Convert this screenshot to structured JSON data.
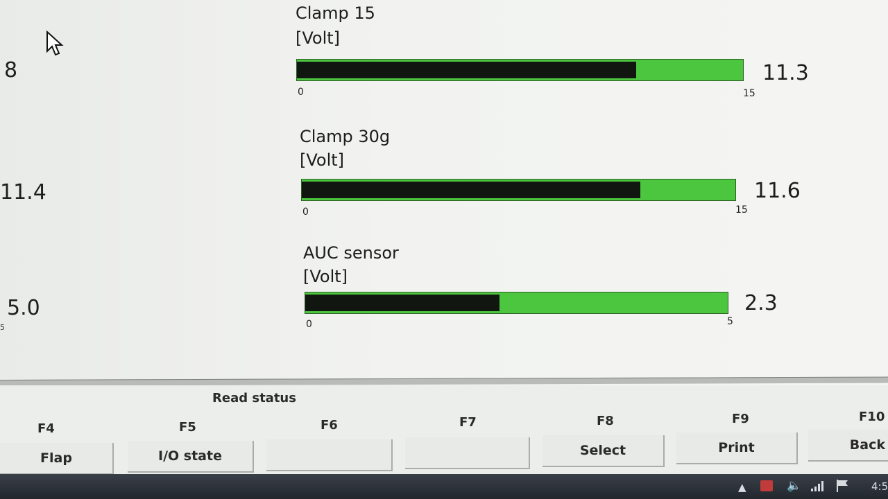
{
  "left_values": [
    "8",
    "11.4",
    "5.0"
  ],
  "left_tiny": "5",
  "gauges": [
    {
      "title": "Clamp 15",
      "unit": "[Volt]",
      "min": "0",
      "max": "15",
      "value": "11.3",
      "fill_fraction": 0.76
    },
    {
      "title": "Clamp 30g",
      "unit": "[Volt]",
      "min": "0",
      "max": "15",
      "value": "11.6",
      "fill_fraction": 0.78
    },
    {
      "title": "AUC sensor",
      "unit": "[Volt]",
      "min": "0",
      "max": "5",
      "value": "2.3",
      "fill_fraction": 0.46
    }
  ],
  "colors": {
    "bar_background": "#4cc63e",
    "bar_fill": "#111611"
  },
  "footer": {
    "section_label": "Read status",
    "fkeys": [
      {
        "key": "F4",
        "label": "Flap"
      },
      {
        "key": "F5",
        "label": "I/O state"
      },
      {
        "key": "F6",
        "label": ""
      },
      {
        "key": "F7",
        "label": ""
      },
      {
        "key": "F8",
        "label": "Select"
      },
      {
        "key": "F9",
        "label": "Print"
      },
      {
        "key": "F10",
        "label": "Back"
      }
    ]
  },
  "taskbar": {
    "clock": "4:5",
    "icons": [
      "chevron-up-icon",
      "network-error-icon",
      "volume-icon",
      "signal-icon",
      "flag-icon"
    ]
  }
}
